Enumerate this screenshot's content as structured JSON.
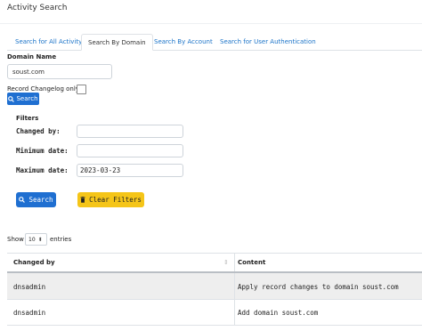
{
  "header": {
    "title": "Activity Search"
  },
  "tabs": [
    {
      "label": "Search for All Activity",
      "active": false
    },
    {
      "label": "Search By Domain",
      "active": true
    },
    {
      "label": "Search By Account",
      "active": false
    },
    {
      "label": "Search for User Authentication",
      "active": false
    }
  ],
  "domain_form": {
    "domain_label": "Domain Name",
    "domain_value": "soust.com",
    "record_changelog_label": "Record Changelog only",
    "record_changelog_checked": false,
    "search_label": "Search"
  },
  "filters": {
    "title": "Filters",
    "changed_by_label": "Changed by:",
    "changed_by_value": "",
    "min_date_label": "Minimum date:",
    "min_date_value": "",
    "max_date_label": "Maximum date:",
    "max_date_value": "2023-03-23",
    "search_label": "Search",
    "clear_label": "Clear Filters"
  },
  "entries": {
    "show_label": "Show",
    "value": "10",
    "suffix": "entries"
  },
  "table": {
    "columns": [
      "Changed by",
      "Content"
    ],
    "rows": [
      {
        "changed_by": "dnsadmin",
        "content": "Apply record changes to domain soust.com"
      },
      {
        "changed_by": "dnsadmin",
        "content": "Add domain soust.com"
      }
    ]
  },
  "colors": {
    "primary": "#1f6fd1",
    "warning": "#f5c518",
    "link": "#1a73c8",
    "striped_row": "#eeeeee"
  }
}
